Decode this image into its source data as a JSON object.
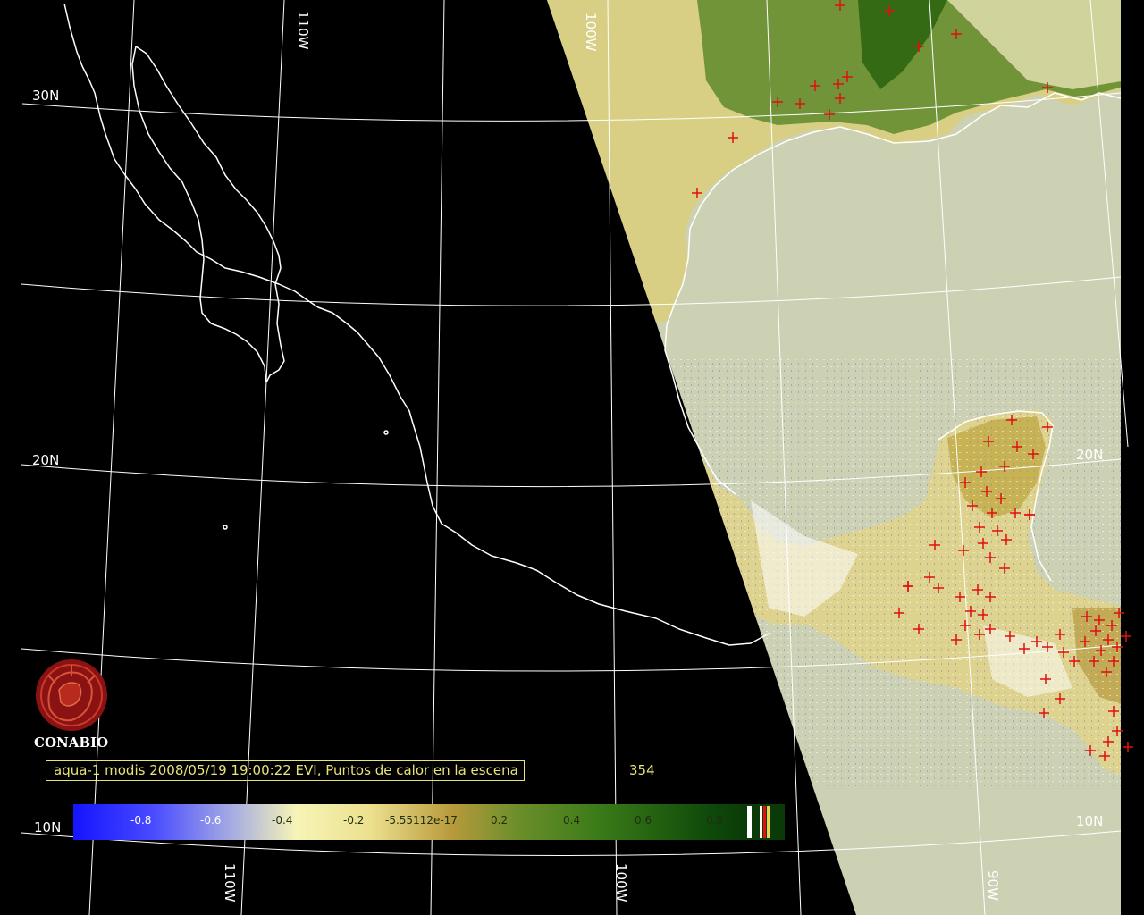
{
  "map": {
    "lat_labels": [
      "30N",
      "20N",
      "10N",
      "20N",
      "10N"
    ],
    "lon_labels": [
      "110W",
      "110W",
      "100W",
      "100W",
      "90W"
    ]
  },
  "logo": {
    "text": "CONABIO",
    "icon": "conabio-logo-icon"
  },
  "info": {
    "caption": "aqua-1 modis 2008/05/19 19:00:22 EVI, Puntos de calor en la escena",
    "count": "354"
  },
  "colorbar": {
    "ticks": [
      "-0.8",
      "-0.6",
      "-0.4",
      "-0.2",
      "-5.55112e-17",
      "0.2",
      "0.4",
      "0.6",
      "0.8"
    ],
    "colors": {
      "low": "#1414ff",
      "mid": "#f4f0a6",
      "high_mid": "#b8a23c",
      "high": "#0f4a0a"
    }
  },
  "colors": {
    "grid": "#ffffff",
    "coast": "#ffffff",
    "ocean_swath": "#cdd1b4",
    "land_yellow": "#e3db96",
    "land_green": "#557d24",
    "hotspot": "#e01010",
    "caption": "#e9e27a"
  }
}
